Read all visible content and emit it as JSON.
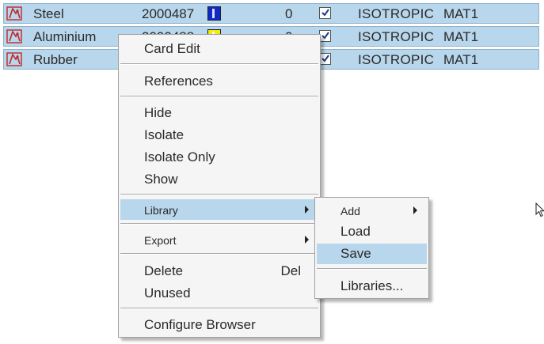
{
  "rows": [
    {
      "name": "Steel",
      "id": "2000487",
      "color": "#1028c8",
      "count": "0",
      "type": "ISOTROPIC",
      "cardimage": "MAT1"
    },
    {
      "name": "Aluminium",
      "id": "2000488",
      "color": "#f2ea10",
      "count": "0",
      "type": "ISOTROPIC",
      "cardimage": "MAT1"
    },
    {
      "name": "Rubber",
      "id": "",
      "color": "",
      "count": "",
      "type": "ISOTROPIC",
      "cardimage": "MAT1"
    }
  ],
  "context_menu": {
    "items": [
      {
        "label": "Card Edit"
      },
      {
        "label": "References"
      },
      {
        "label": "Hide"
      },
      {
        "label": "Isolate"
      },
      {
        "label": "Isolate Only"
      },
      {
        "label": "Show"
      },
      {
        "label": "Library"
      },
      {
        "label": "Export"
      },
      {
        "label": "Delete",
        "shortcut": "Del"
      },
      {
        "label": "Unused"
      },
      {
        "label": "Configure Browser"
      }
    ]
  },
  "library_submenu": {
    "items": [
      {
        "label": "Add"
      },
      {
        "label": "Load"
      },
      {
        "label": "Save"
      },
      {
        "label": "Libraries..."
      }
    ]
  },
  "icons": {
    "material": "material-icon",
    "checkbox": "checkbox-checked-icon",
    "submenu_arrow": "triangle-right-icon",
    "cursor": "mouse-pointer-icon"
  },
  "colors": {
    "row_highlight": "#b8d6ec",
    "menu_background": "#f5f5f5",
    "menu_highlight": "#b8d6ec"
  }
}
